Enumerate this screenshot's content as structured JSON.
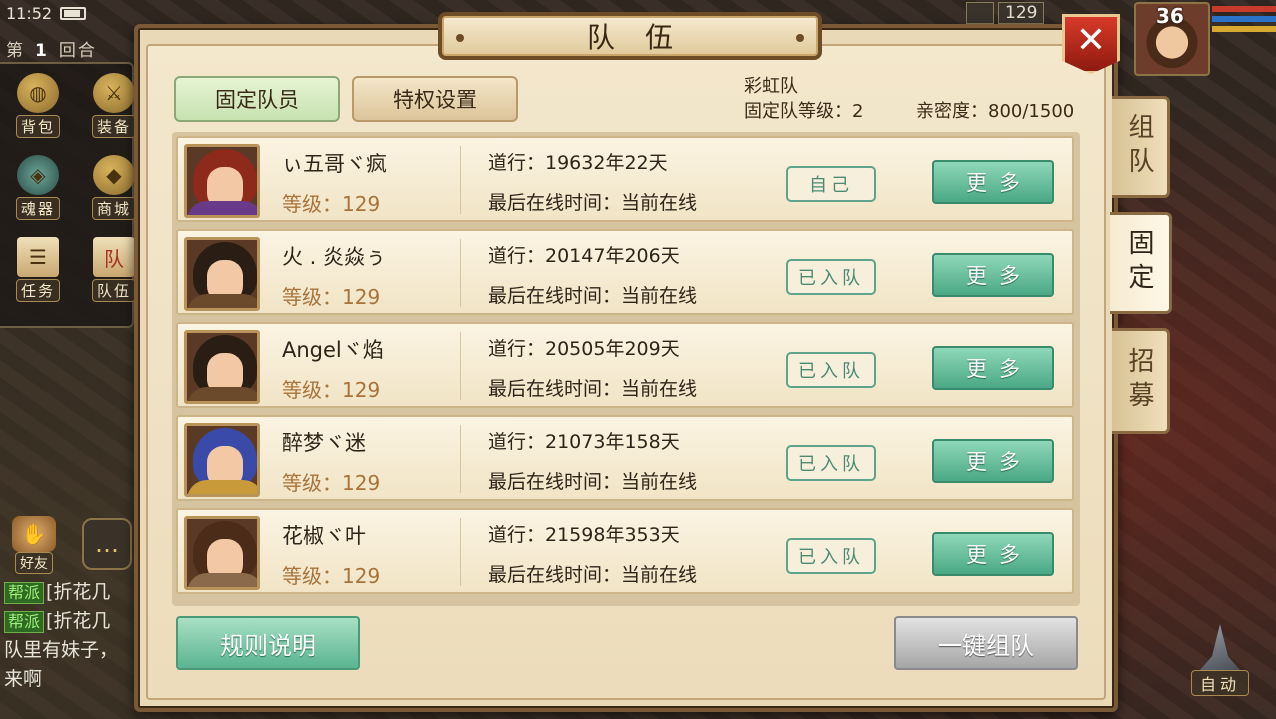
{
  "status_bar": {
    "time": "11:52"
  },
  "hud": {
    "round_prefix": "第",
    "round_number": "1",
    "round_suffix": "回合",
    "top_right_value": "129",
    "player_level": "36"
  },
  "left_menu": [
    {
      "label": "背包",
      "icon": "bag-icon"
    },
    {
      "label": "装备",
      "icon": "equipment-icon"
    },
    {
      "label": "魂器",
      "icon": "soul-vessel-icon"
    },
    {
      "label": "商城",
      "icon": "shop-icon"
    },
    {
      "label": "任务",
      "icon": "quest-scroll-icon"
    },
    {
      "label": "队伍",
      "icon": "team-icon"
    }
  ],
  "friend_button": {
    "label": "好友"
  },
  "chat": {
    "lines": [
      {
        "tag": "帮派",
        "text": "[折花几"
      },
      {
        "tag": "帮派",
        "text": "[折花几"
      }
    ],
    "message": "队里有妹子，来啊"
  },
  "auto_button": {
    "label": "自动"
  },
  "dialog": {
    "title": "队伍",
    "close_label": "✕",
    "tabs": [
      {
        "label": "固定队员",
        "active": true
      },
      {
        "label": "特权设置",
        "active": false
      }
    ],
    "team_name": "彩虹队",
    "team_level": "固定队等级：2",
    "intimacy": "亲密度：800/1500",
    "side_tabs": [
      {
        "label": "组队",
        "active": false
      },
      {
        "label": "固定",
        "active": true
      },
      {
        "label": "招募",
        "active": false
      }
    ],
    "members": [
      {
        "name": "ぃ五哥ヾ疯",
        "level": "等级：129",
        "daoxing": "道行：19632年22天",
        "online": "最后在线时间：当前在线",
        "status": "自己",
        "more": "更多",
        "portrait_color": "#8e2a1c"
      },
      {
        "name": "火 . 炎焱ぅ",
        "level": "等级：129",
        "daoxing": "道行：20147年206天",
        "online": "最后在线时间：当前在线",
        "status": "已入队",
        "more": "更多",
        "portrait_color": "#2a1e14"
      },
      {
        "name": "Angelヾ焰",
        "level": "等级：129",
        "daoxing": "道行：20505年209天",
        "online": "最后在线时间：当前在线",
        "status": "已入队",
        "more": "更多",
        "portrait_color": "#2a1e14"
      },
      {
        "name": "醉梦ヾ迷",
        "level": "等级：129",
        "daoxing": "道行：21073年158天",
        "online": "最后在线时间：当前在线",
        "status": "已入队",
        "more": "更多",
        "portrait_color": "#3a4aa8"
      },
      {
        "name": "花椒ヾ叶",
        "level": "等级：129",
        "daoxing": "道行：21598年353天",
        "online": "最后在线时间：当前在线",
        "status": "已入队",
        "more": "更多",
        "portrait_color": "#4a2c18"
      }
    ],
    "rules_button": "规则说明",
    "form_team_button": "一键组队"
  },
  "colors": {
    "accent_green": "#5ab492",
    "parchment": "#f3e7cc",
    "frame_brown": "#7a5a36",
    "close_red": "#c8301e"
  }
}
